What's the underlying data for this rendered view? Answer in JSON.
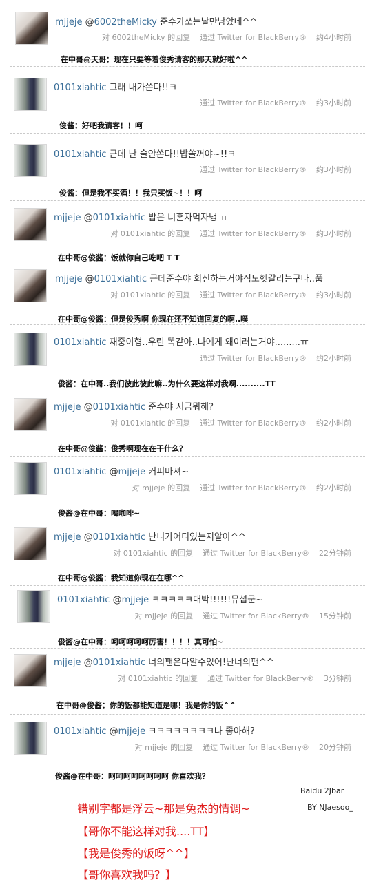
{
  "tweets": [
    {
      "user": "mjjeje",
      "mention": "@6002theMicky",
      "text": "준수가쏘는날만남았네^^",
      "reply_to": "对 6002theMicky 的回复",
      "via": "通过 Twitter for BlackBerry®",
      "time": "约4小时前",
      "caption": "在中哥@天哥：现在只要等着俊秀请客的那天就好啦^^",
      "avatar": "mjjeje-avatar"
    },
    {
      "user": "0101xiahtic",
      "mention": "",
      "text": "그래 내가쏜다!!ㅋ",
      "reply_to": "",
      "via": "通过 Twitter for BlackBerry®",
      "time": "约3小时前",
      "caption": "俊酱：好吧我请客！！呵",
      "avatar": "0101xiahtic-avatar"
    },
    {
      "user": "0101xiahtic",
      "mention": "",
      "text": "근데 난 술안쏜다!!밥쏠꺼야~!!ㅋ",
      "reply_to": "",
      "via": "通过 Twitter for BlackBerry®",
      "time": "约3小时前",
      "caption": "俊酱：但是我不买酒！！我只买饭~！！呵",
      "avatar": "0101xiahtic-avatar"
    },
    {
      "user": "mjjeje",
      "mention": "@0101xiahtic",
      "text": "밥은 너혼자먹자냉 ㅠ",
      "reply_to": "对 0101xiahtic 的回复",
      "via": "通过 Twitter for BlackBerry®",
      "time": "约3小时前",
      "caption": "在中哥@俊酱：饭就你自己吃吧 T T",
      "avatar": "mjjeje-avatar"
    },
    {
      "user": "mjjeje",
      "mention": "@0101xiahtic",
      "text": "근데준수야 회신하는거야직도헷갈리는구나..풉",
      "reply_to": "对 0101xiahtic 的回复",
      "via": "通过 Twitter for BlackBerry®",
      "time": "约3小时前",
      "caption": "在中哥@俊酱：但是俊秀啊 你现在还不知道回复的啊..噗",
      "avatar": "mjjeje-avatar"
    },
    {
      "user": "0101xiahtic",
      "mention": "",
      "text": "재중이형..우린 똑같아..나에게 왜이러는거야.........ㅠ",
      "reply_to": "",
      "via": "通过 Twitter for BlackBerry®",
      "time": "约2小时前",
      "caption": "俊酱：在中哥..我们彼此彼此嘛..为什么要这样对我啊..........TT",
      "avatar": "0101xiahtic-avatar"
    },
    {
      "user": "mjjeje",
      "mention": "@0101xiahtic",
      "text": "준수야 지금뭐해?",
      "reply_to": "对 0101xiahtic 的回复",
      "via": "通过 Twitter for BlackBerry®",
      "time": "约2小时前",
      "caption": "在中哥@俊酱：俊秀啊现在在干什么？",
      "avatar": "mjjeje-avatar"
    },
    {
      "user": "0101xiahtic",
      "mention": "@mjjeje",
      "text": "커피마셔~",
      "reply_to": "对 mjjeje 的回复",
      "via": "通过 Twitter for BlackBerry®",
      "time": "约2小时前",
      "caption": "俊酱@在中哥：喝咖啡~",
      "avatar": "0101xiahtic-avatar"
    },
    {
      "user": "mjjeje",
      "mention": "@0101xiahtic",
      "text": "난니가어디있는지알아^^",
      "reply_to": "对 0101xiahtic 的回复",
      "via": "通过 Twitter for BlackBerry®",
      "time": "22分钟前",
      "caption": "在中哥@俊酱：我知道你现在在哪^^",
      "avatar": "mjjeje-avatar"
    },
    {
      "user": "0101xiahtic",
      "mention": "@mjjeje",
      "text": "ㅋㅋㅋㅋㅋ대박!!!!!!뮤섭군~",
      "reply_to": "对 mjjeje 的回复",
      "via": "通过 Twitter for BlackBerry®",
      "time": "15分钟前",
      "caption": "俊酱@在中哥：呵呵呵呵呵厉害！！！！真可怕~",
      "avatar": "0101xiahtic-avatar"
    },
    {
      "user": "mjjeje",
      "mention": "@0101xiahtic",
      "text": "너의팬은다알수있어!난너의팬^^",
      "reply_to": "对 0101xiahtic 的回复",
      "via": "通过 Twitter for BlackBerry®",
      "time": "3分钟前",
      "caption": "在中哥@俊酱：你的饭都能知道是哪！我是你的饭^^",
      "avatar": "mjjeje-avatar"
    },
    {
      "user": "0101xiahtic",
      "mention": "@mjjeje",
      "text": "ㅋㅋㅋㅋㅋㅋㅋㅋ나 좋아해?",
      "reply_to": "对 mjjeje 的回复",
      "via": "通过 Twitter for BlackBerry®",
      "time": "20分钟前",
      "caption": "俊酱@在中哥：呵呵呵呵呵呵呵呵 你喜欢我？",
      "avatar": "0101xiahtic-avatar"
    }
  ],
  "credits": {
    "line1": "Baidu 2Jbar",
    "line2": "BY NJaesoo_"
  },
  "notes": [
    "错别字都是浮云~那是兔杰的情调~",
    "【哥你不能这样对我....TT】",
    "【我是俊秀的饭呀^^】",
    "【哥你喜欢我吗？】"
  ],
  "colors": {
    "username": "#3b6f99",
    "meta": "#9a9a9a",
    "note": "#e02020"
  }
}
